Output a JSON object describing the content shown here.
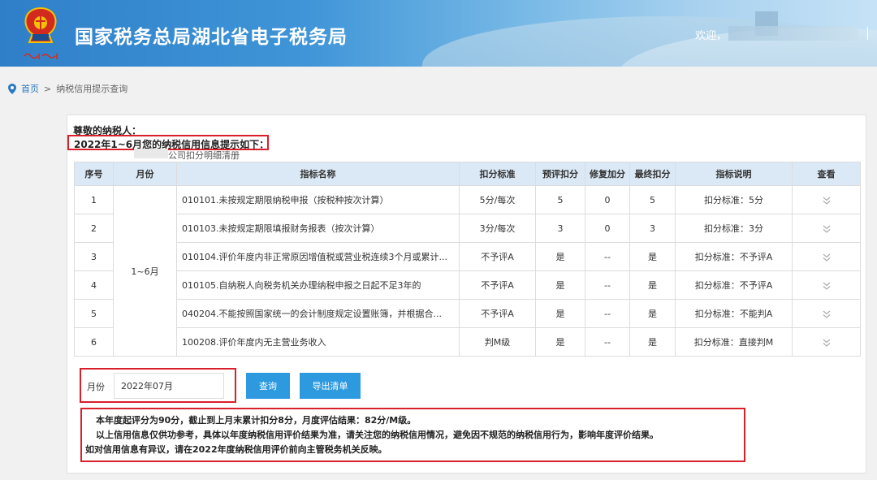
{
  "header": {
    "site_title": "国家税务总局湖北省电子税务局",
    "welcome": "欢迎，"
  },
  "breadcrumb": {
    "home": "首页",
    "separator": ">",
    "current": "纳税信用提示查询"
  },
  "intro": {
    "greeting": "尊敬的纳税人：",
    "info_title": "2022年1~6月您的纳税信用信息提示如下：",
    "detail_link": "公司扣分明细清册"
  },
  "table": {
    "headers": [
      "序号",
      "月份",
      "指标名称",
      "扣分标准",
      "预评扣分",
      "修复加分",
      "最终扣分",
      "指标说明",
      "查看"
    ],
    "month_span": "1~6月",
    "rows": [
      {
        "no": "1",
        "name": "010101.未按规定期限纳税申报（按税种按次计算）",
        "standard": "5分/每次",
        "pre": "5",
        "repair": "0",
        "final": "5",
        "desc": "扣分标准：5分"
      },
      {
        "no": "2",
        "name": "010103.未按规定期限填报财务报表（按次计算）",
        "standard": "3分/每次",
        "pre": "3",
        "repair": "0",
        "final": "3",
        "desc": "扣分标准：3分"
      },
      {
        "no": "3",
        "name": "010104.评价年度内非正常原因增值税或营业税连续3个月或累计...",
        "standard": "不予评A",
        "pre": "是",
        "repair": "--",
        "final": "是",
        "desc": "扣分标准：不予评A"
      },
      {
        "no": "4",
        "name": "010105.自纳税人向税务机关办理纳税申报之日起不足3年的",
        "standard": "不予评A",
        "pre": "是",
        "repair": "--",
        "final": "是",
        "desc": "扣分标准：不予评A"
      },
      {
        "no": "5",
        "name": "040204.不能按照国家统一的会计制度规定设置账簿，并根据合...",
        "standard": "不予评A",
        "pre": "是",
        "repair": "--",
        "final": "是",
        "desc": "扣分标准：不能判A"
      },
      {
        "no": "6",
        "name": "100208.评价年度内无主营业务收入",
        "standard": "判M级",
        "pre": "是",
        "repair": "--",
        "final": "是",
        "desc": "扣分标准：直接判M"
      }
    ]
  },
  "controls": {
    "month_label": "月份",
    "month_value": "2022年07月",
    "query_button": "查询",
    "export_button": "导出清单"
  },
  "notes": {
    "line1": "本年度起评分为90分，截止到上月末累计扣分8分，月度评估结果：82分/M级。",
    "line2": "以上信用信息仅供功参考，具体以年度纳税信用评价结果为准，请关注您的纳税信用情况，避免因不规范的纳税信用行为，影响年度评价结果。",
    "line3": "如对信用信息有异议，请在2022年度纳税信用评价前向主管税务机关反映。"
  },
  "colors": {
    "header_blue": "#2f7fc8",
    "table_header": "#dbe9f6",
    "button_blue": "#2d9ae0",
    "highlight_red": "#d9202a",
    "link_blue": "#2a7ac2"
  },
  "icons": [
    "tax-emblem-icon",
    "location-pin-icon",
    "double-chevron-down-icon"
  ]
}
